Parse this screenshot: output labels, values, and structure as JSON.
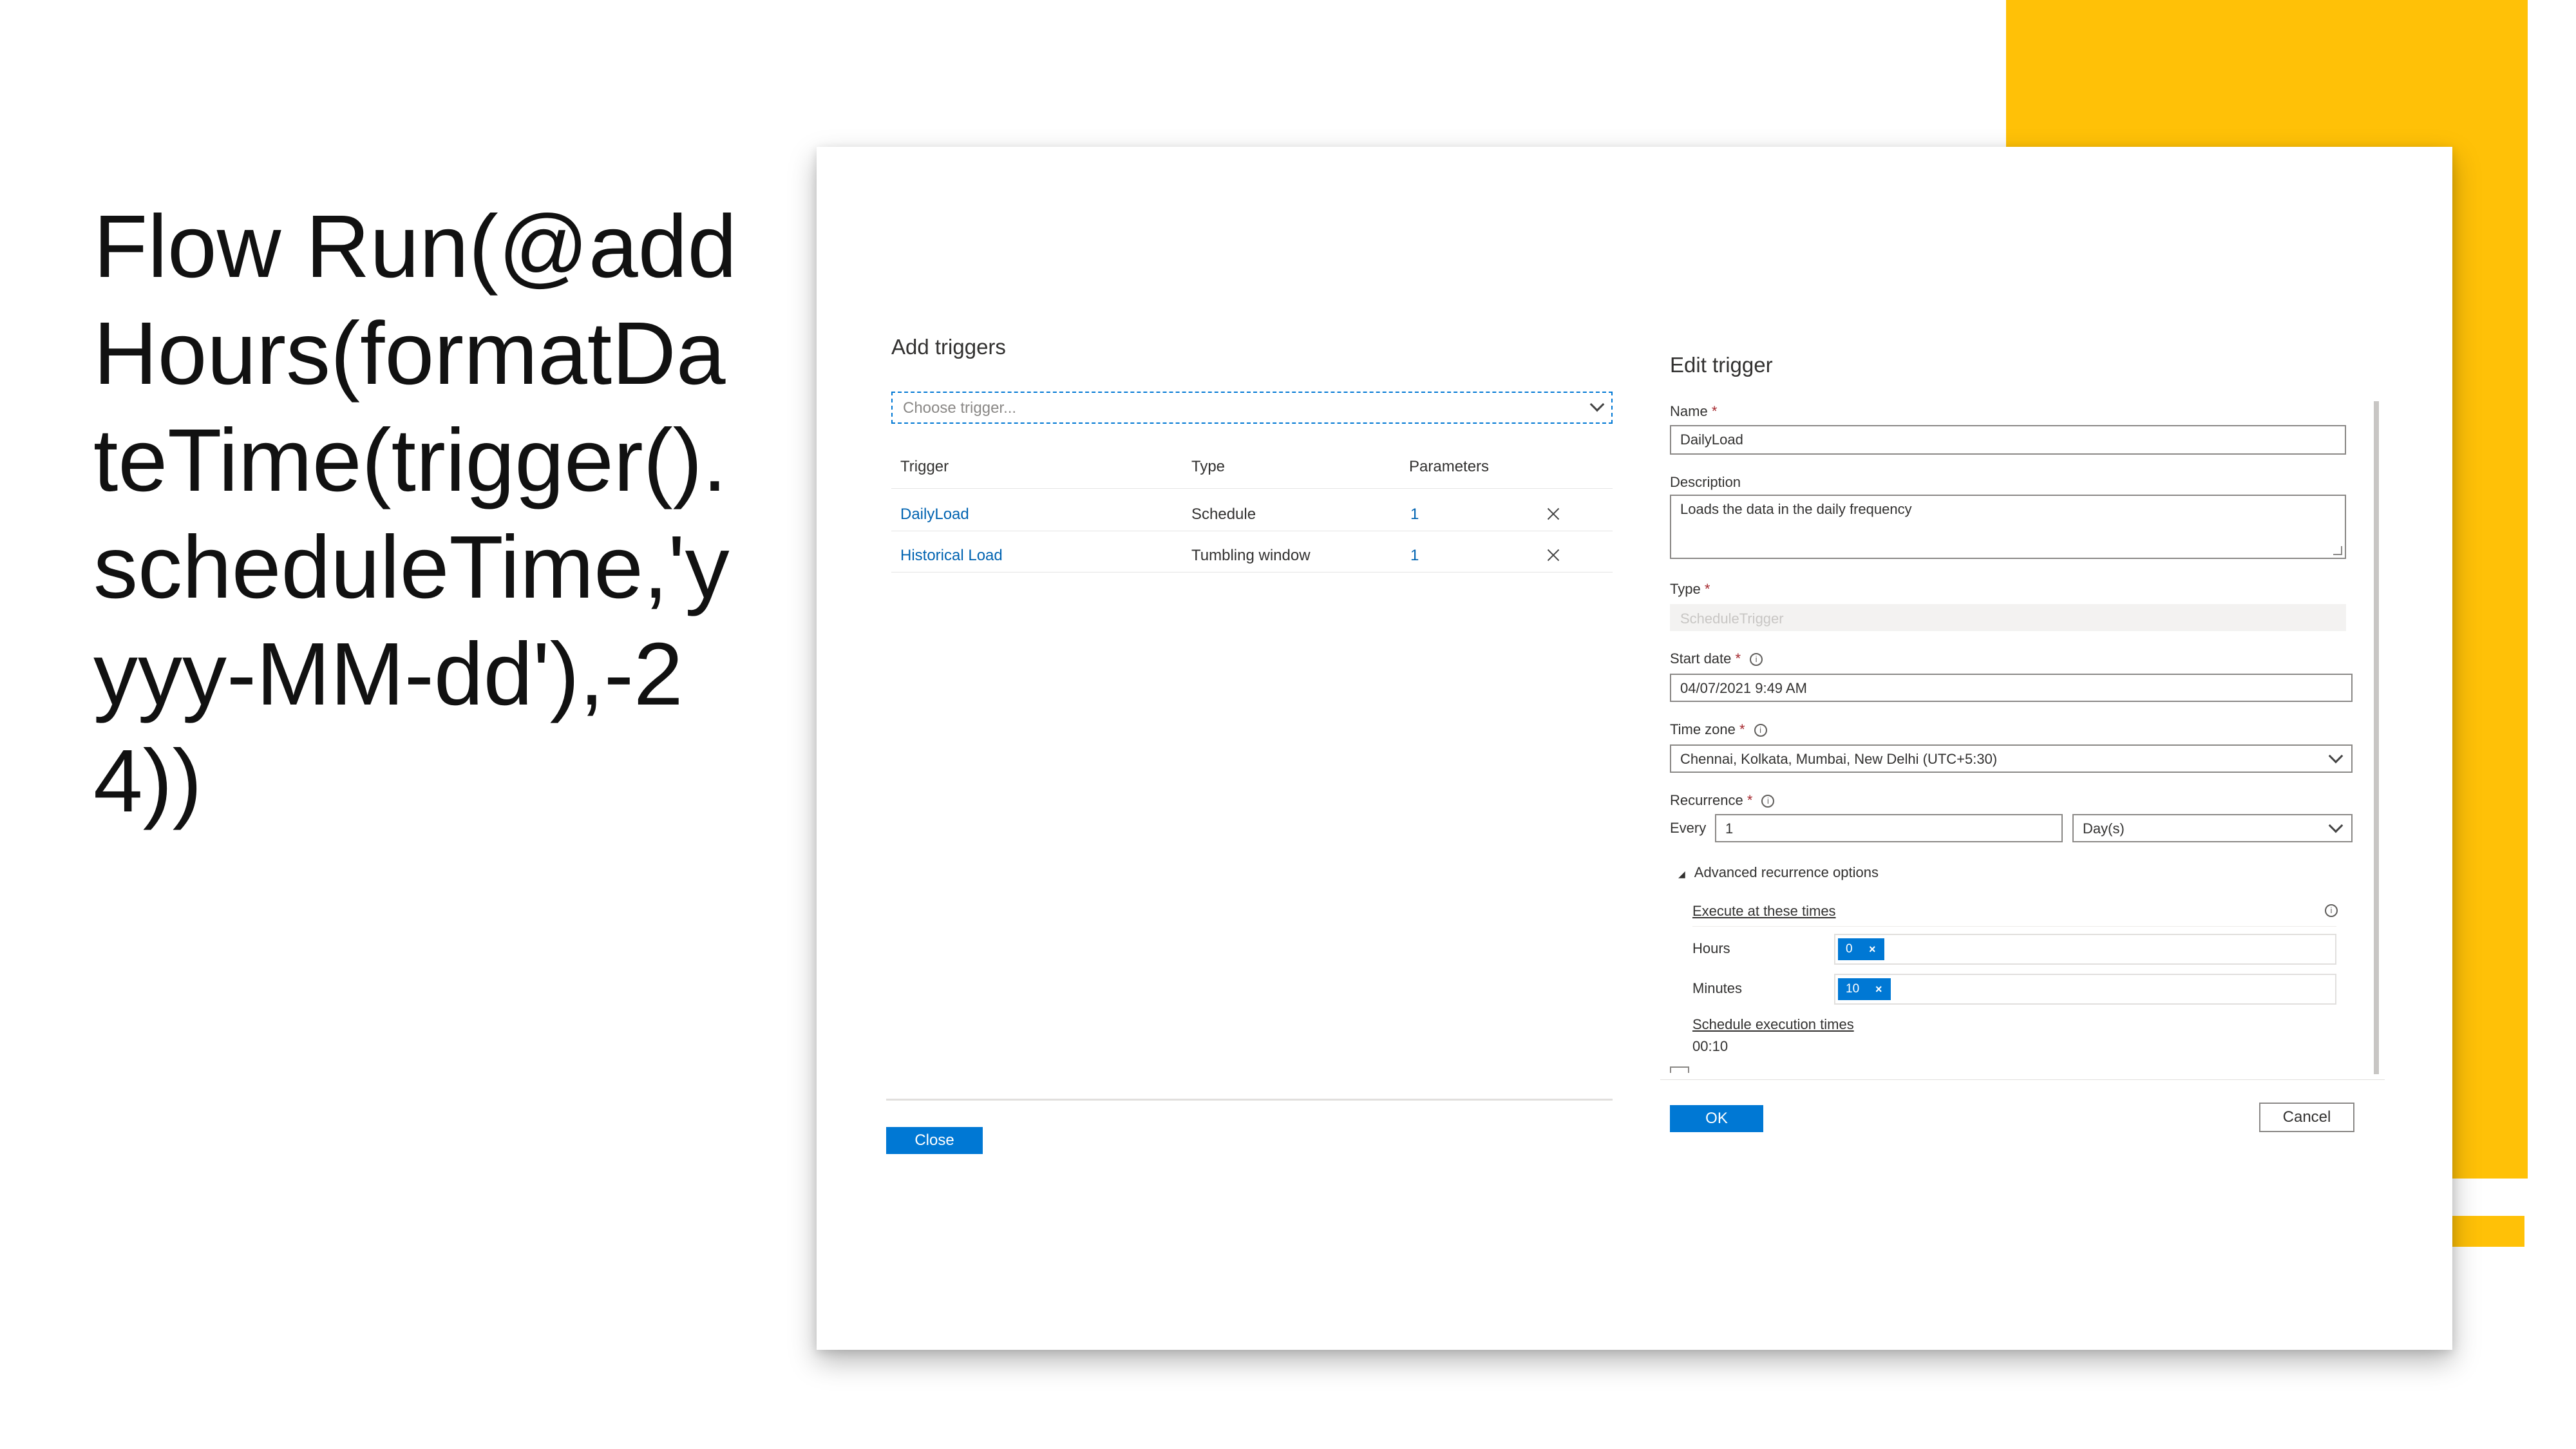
{
  "slide": {
    "title": "Flow Run(@addHours(formatDateTime(trigger().scheduleTime,'yyyy-MM-dd'),-24))",
    "accent_color": "#FFC107"
  },
  "add_triggers": {
    "title": "Add triggers",
    "dropdown_placeholder": "Choose trigger...",
    "columns": [
      "Trigger",
      "Type",
      "Parameters"
    ],
    "rows": [
      {
        "trigger": "DailyLoad",
        "type": "Schedule",
        "parameters": "1"
      },
      {
        "trigger": "Historical Load",
        "type": "Tumbling window",
        "parameters": "1"
      }
    ],
    "close_label": "Close"
  },
  "edit_trigger": {
    "title": "Edit trigger",
    "name_label": "Name",
    "name_value": "DailyLoad",
    "description_label": "Description",
    "description_value": "Loads the data in the daily frequency",
    "type_label": "Type",
    "type_value": "ScheduleTrigger",
    "start_date_label": "Start date",
    "start_date_value": "04/07/2021 9:49 AM",
    "time_zone_label": "Time zone",
    "time_zone_value": "Chennai, Kolkata, Mumbai, New Delhi (UTC+5:30)",
    "recurrence_label": "Recurrence",
    "every_label": "Every",
    "every_value": "1",
    "unit_value": "Day(s)",
    "advanced_label": "Advanced recurrence options",
    "execute_link": "Execute at these times",
    "hours_label": "Hours",
    "hours_tag": "0",
    "minutes_label": "Minutes",
    "minutes_tag": "10",
    "schedule_link": "Schedule execution times",
    "schedule_value": "00:10",
    "required_mark": "*",
    "info_glyph": "i",
    "remove_glyph": "×",
    "collapse_glyph": "◢",
    "ok_label": "OK",
    "cancel_label": "Cancel"
  },
  "icons": [
    "chevron-down-icon",
    "close-icon",
    "info-icon",
    "tag-remove-icon",
    "collapse-triangle-icon"
  ]
}
